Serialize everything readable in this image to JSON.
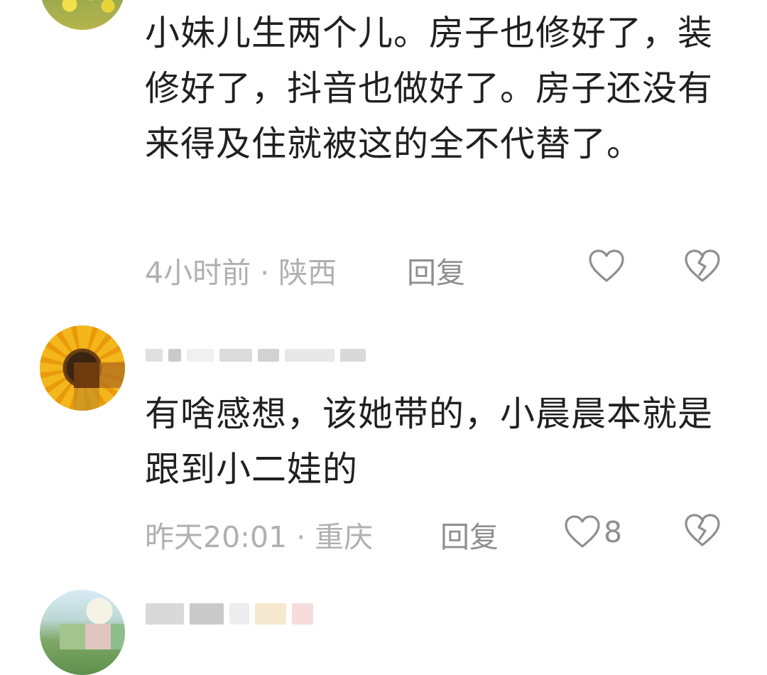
{
  "comments": [
    {
      "text": "小妹儿生两个儿。房子也修好了，装修好了，抖音也做好了。房子还没有来得及住就被这的全不代替了。",
      "time_location": "4小时前 · 陕西",
      "reply_label": "回复",
      "like_count": "",
      "avatar_icon": "avatar-yellow-flowers"
    },
    {
      "text": "有啥感想，该她带的，小晨晨本就是跟到小二娃的",
      "time_location": "昨天20:01 · 重庆",
      "reply_label": "回复",
      "like_count": "8",
      "avatar_icon": "avatar-sunflower"
    },
    {
      "avatar_icon": "avatar-landscape"
    }
  ],
  "icons": {
    "like": "heart-outline-icon",
    "dislike": "broken-heart-icon"
  },
  "colors": {
    "text": "#202020",
    "meta": "#b0b0b0",
    "action": "#8f8f8f"
  }
}
